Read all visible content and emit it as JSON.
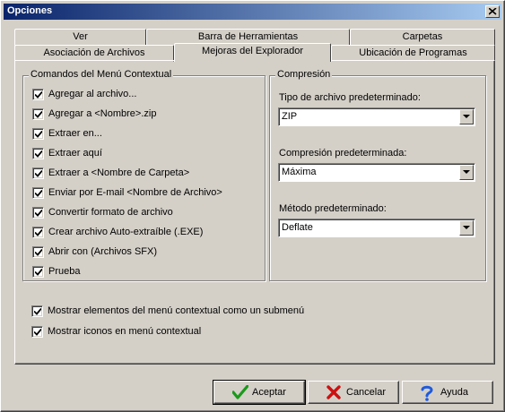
{
  "window": {
    "title": "Opciones"
  },
  "tabs": {
    "row1": [
      {
        "label": "Ver"
      },
      {
        "label": "Barra de Herramientas"
      },
      {
        "label": "Carpetas"
      }
    ],
    "row2": [
      {
        "label": "Asociación de Archivos"
      },
      {
        "label": "Mejoras del Explorador",
        "active": true
      },
      {
        "label": "Ubicación de Programas"
      }
    ]
  },
  "context_menu_group": {
    "label": "Comandos del Menú Contextual",
    "items": [
      {
        "label": "Agregar al archivo...",
        "checked": true
      },
      {
        "label": "Agregar a <Nombre>.zip",
        "checked": true
      },
      {
        "label": "Extraer en...",
        "checked": true
      },
      {
        "label": "Extraer aquí",
        "checked": true
      },
      {
        "label": "Extraer a <Nombre de Carpeta>",
        "checked": true
      },
      {
        "label": "Enviar por E-mail <Nombre de Archivo>",
        "checked": true
      },
      {
        "label": "Convertir formato de archivo",
        "checked": true
      },
      {
        "label": "Crear archivo Auto-extraíble (.EXE)",
        "checked": true
      },
      {
        "label": "Abrir con (Archivos SFX)",
        "checked": true
      },
      {
        "label": "Prueba",
        "checked": true
      }
    ]
  },
  "compression_group": {
    "label": "Compresión",
    "file_type": {
      "label": "Tipo de archivo predeterminado:",
      "value": "ZIP"
    },
    "compression": {
      "label": "Compresión predeterminada:",
      "value": "Máxima"
    },
    "method": {
      "label": "Método predeterminado:",
      "value": "Deflate"
    }
  },
  "options": [
    {
      "label": "Mostrar elementos del menú contextual como un submenú",
      "checked": true
    },
    {
      "label": "Mostrar iconos en menú contextual",
      "checked": true
    }
  ],
  "buttons": {
    "accept": "Aceptar",
    "cancel": "Cancelar",
    "help": "Ayuda"
  },
  "colors": {
    "title_start": "#0a246a",
    "title_end": "#a6caf0",
    "face": "#d4d0c8",
    "accept_icon": "#1a9a1a",
    "cancel_icon": "#cc1111",
    "help_icon": "#1e5adc"
  }
}
